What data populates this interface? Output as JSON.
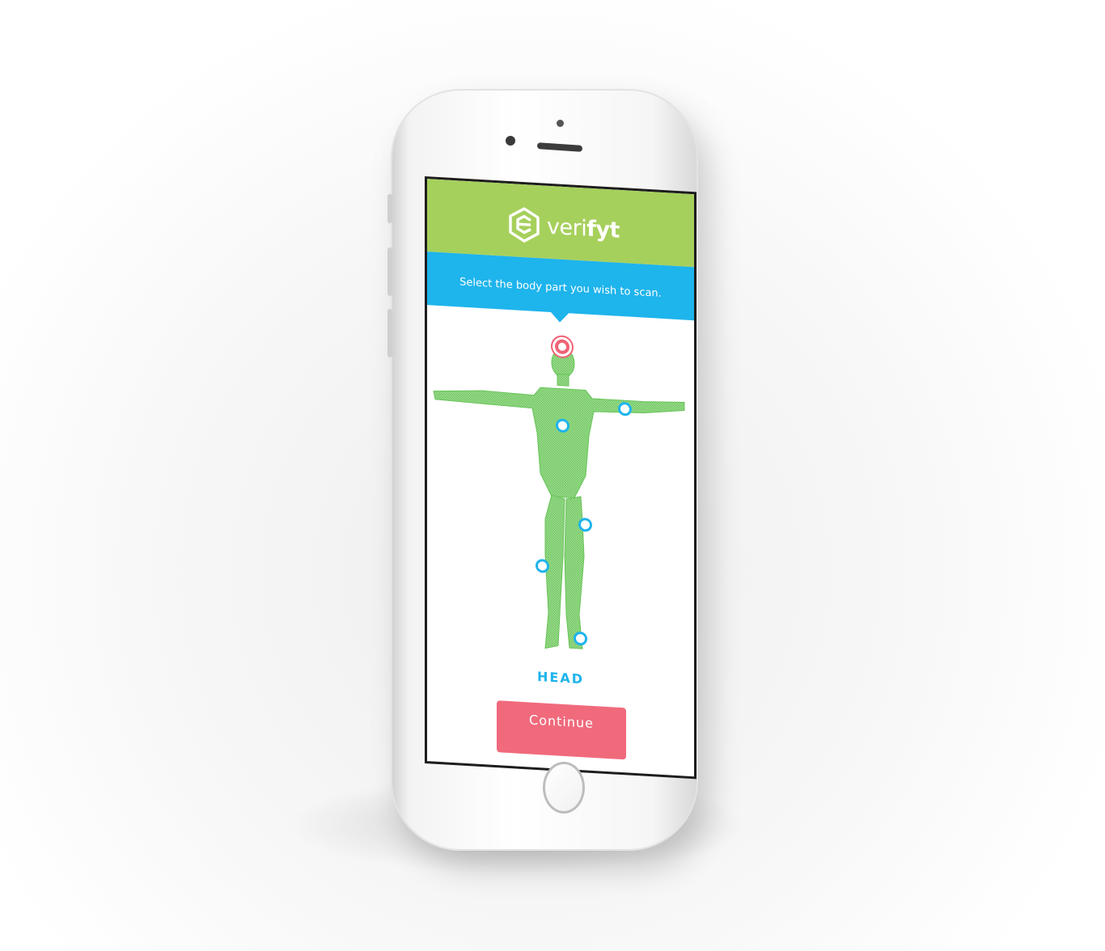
{
  "app": {
    "brand_prefix": "veri",
    "brand_suffix": "fyt",
    "colors": {
      "header_green": "#a6d05c",
      "banner_blue": "#1eb4ec",
      "marker_blue": "#1eb4ec",
      "marker_active_red": "#f06275",
      "button_red": "#f06a7c",
      "figure_green": "#8fd77a"
    }
  },
  "banner": {
    "instruction": "Select the body part you wish to scan."
  },
  "body_map": {
    "selected_part_label": "HEAD",
    "icons": {
      "logo": "hexagon-e-logo-icon",
      "body_figure": "human-body-wireframe-icon",
      "marker": "circle-marker-icon"
    }
  },
  "actions": {
    "continue_label": "Continue"
  }
}
